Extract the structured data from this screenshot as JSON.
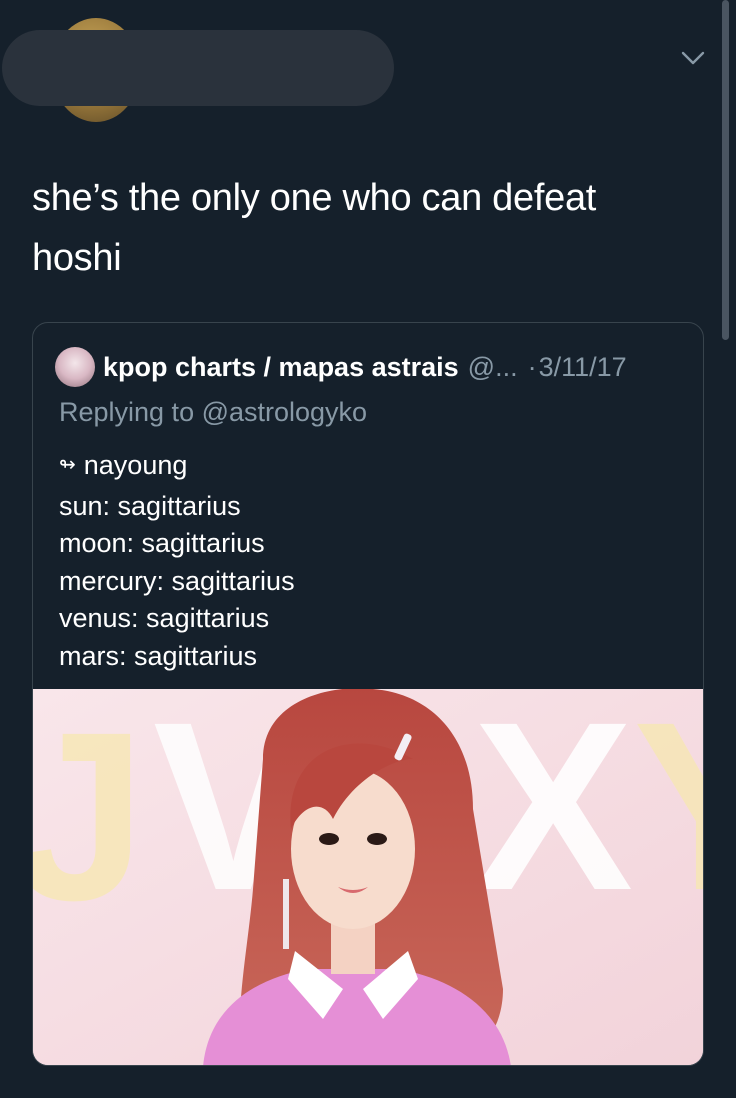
{
  "tweet": {
    "text": "she’s the only one who can defeat hoshi"
  },
  "quote": {
    "display_name": "kpop charts / mapas astrais",
    "handle": "@...",
    "separator": "·",
    "date": "3/11/17",
    "replying_prefix": "Replying to ",
    "replying_handle": "@astrologyko",
    "lines": {
      "title": "nayoung",
      "sun": "sun: sagittarius",
      "moon": "moon: sagittarius",
      "mercury": "mercury: sagittarius",
      "venus": "venus: sagittarius",
      "mars": "mars: sagittarius"
    },
    "title_glyph": "↬",
    "image": {
      "background_letters": "JV   XY"
    }
  },
  "colors": {
    "background": "#15202b",
    "secondary_text": "#8899a6",
    "card_border": "#38444d"
  },
  "icons": {
    "chevron": "chevron-down-icon"
  }
}
